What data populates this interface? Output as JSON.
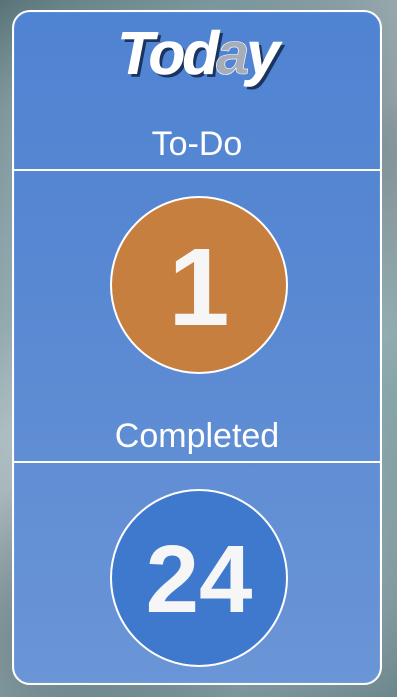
{
  "widget": {
    "logo": {
      "text_1": "Tod",
      "text_2": "a",
      "text_3": "y"
    },
    "todo": {
      "label": "To-Do",
      "count": "1"
    },
    "completed": {
      "label": "Completed",
      "count": "24"
    }
  },
  "colors": {
    "panel": "#5787d2",
    "todo_circle": "#c67f3f",
    "completed_circle": "#3f79ce",
    "text": "#ffffff"
  }
}
